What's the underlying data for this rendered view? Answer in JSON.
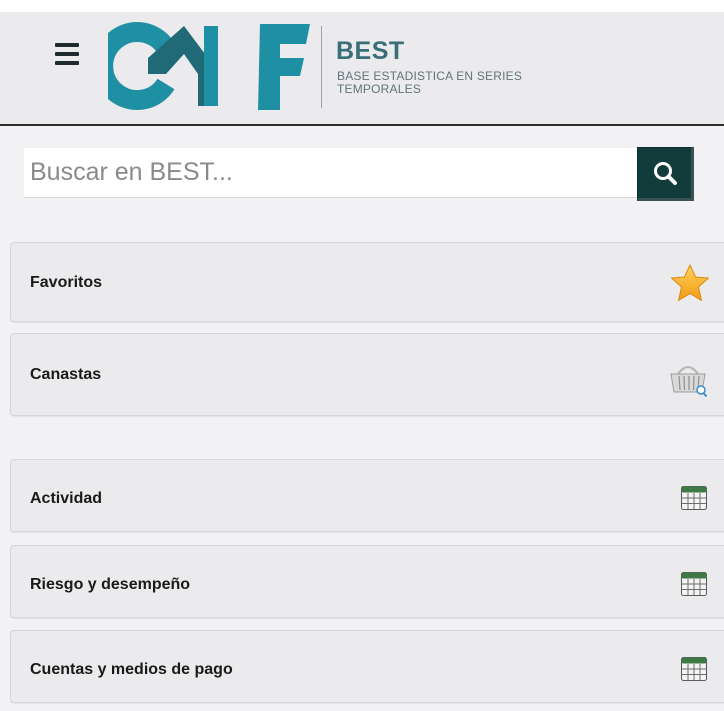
{
  "header": {
    "brand_title": "BEST",
    "brand_subtitle": "BASE ESTADISTICA EN SERIES TEMPORALES",
    "logo_text": "CMF",
    "logo_colors": {
      "teal": "#1f8fa3",
      "dark_teal": "#1f6a76"
    }
  },
  "search": {
    "placeholder": "Buscar en BEST...",
    "value": "",
    "button_color": "#123c3c"
  },
  "menu": {
    "favorites": {
      "label": "Favoritos",
      "icon": "star-icon",
      "icon_color": "#f5a623"
    },
    "baskets": {
      "label": "Canastas",
      "icon": "basket-icon"
    },
    "categories": [
      {
        "label": "Actividad",
        "icon": "table-icon"
      },
      {
        "label": "Riesgo y desempeño",
        "icon": "table-icon"
      },
      {
        "label": "Cuentas y medios de pago",
        "icon": "table-icon"
      }
    ]
  }
}
